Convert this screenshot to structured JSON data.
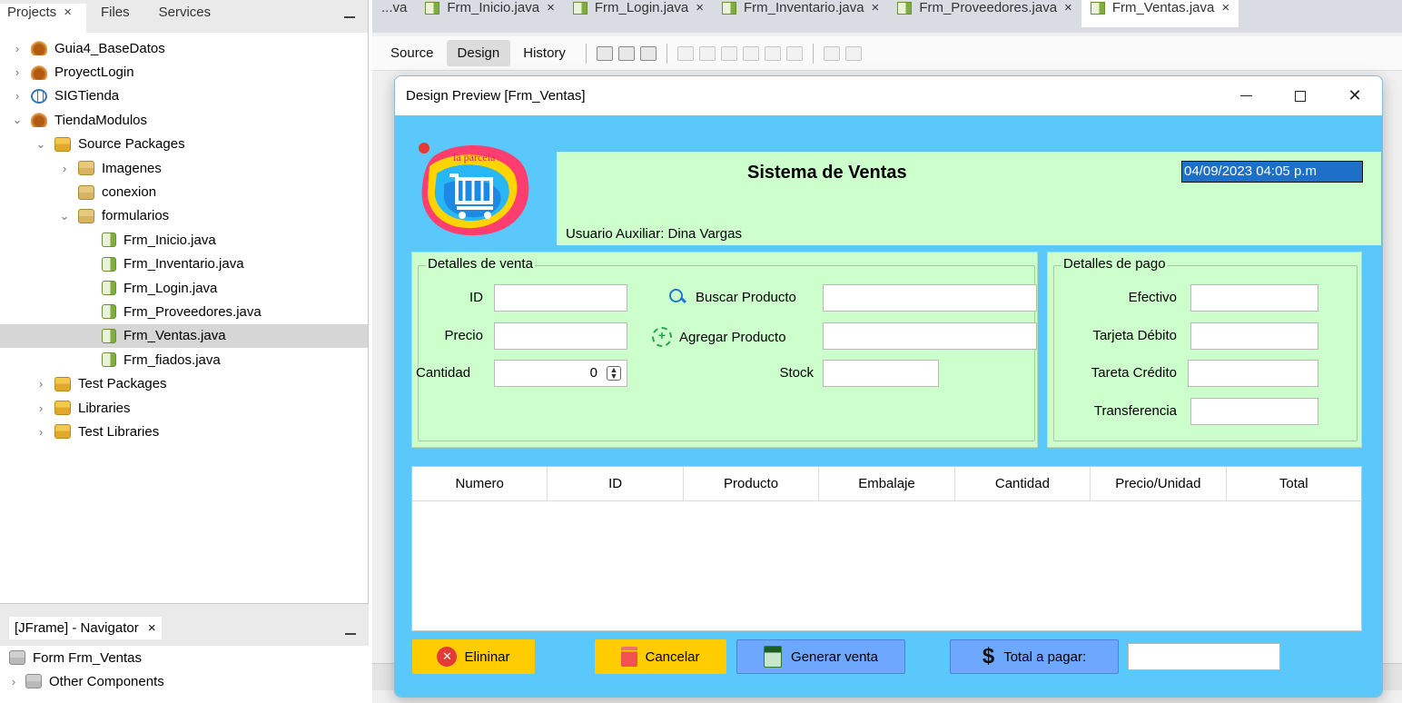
{
  "left_panel": {
    "tabs": [
      {
        "label": "Projects",
        "close": "×"
      },
      {
        "label": "Files"
      },
      {
        "label": "Services"
      }
    ],
    "tree": [
      {
        "label": "Guia4_BaseDatos",
        "icon": "coffee-cup-icon",
        "level": 0,
        "expander": "›"
      },
      {
        "label": "ProyectLogin",
        "icon": "coffee-cup-icon",
        "level": 0,
        "expander": "›"
      },
      {
        "label": "SIGTienda",
        "icon": "globe-icon",
        "level": 0,
        "expander": "›"
      },
      {
        "label": "TiendaModulos",
        "icon": "coffee-cup-icon",
        "level": 0,
        "expander": "⌄"
      },
      {
        "label": "Source Packages",
        "icon": "source-packages-icon",
        "level": 1,
        "expander": "⌄"
      },
      {
        "label": "Imagenes",
        "icon": "package-icon",
        "level": 2,
        "expander": "›"
      },
      {
        "label": "conexion",
        "icon": "package-icon",
        "level": 2,
        "expander": ""
      },
      {
        "label": "formularios",
        "icon": "package-icon",
        "level": 2,
        "expander": "⌄"
      },
      {
        "label": "Frm_Inicio.java",
        "icon": "java-form-icon",
        "level": 3,
        "expander": ""
      },
      {
        "label": "Frm_Inventario.java",
        "icon": "java-form-icon",
        "level": 3,
        "expander": ""
      },
      {
        "label": "Frm_Login.java",
        "icon": "java-form-icon",
        "level": 3,
        "expander": ""
      },
      {
        "label": "Frm_Proveedores.java",
        "icon": "java-form-icon",
        "level": 3,
        "expander": ""
      },
      {
        "label": "Frm_Ventas.java",
        "icon": "java-form-icon",
        "level": 3,
        "expander": "",
        "selected": true
      },
      {
        "label": "Frm_fiados.java",
        "icon": "java-form-icon",
        "level": 3,
        "expander": ""
      },
      {
        "label": "Test Packages",
        "icon": "test-packages-icon",
        "level": 1,
        "expander": "›"
      },
      {
        "label": "Libraries",
        "icon": "libraries-icon",
        "level": 1,
        "expander": "›"
      },
      {
        "label": "Test Libraries",
        "icon": "libraries-icon",
        "level": 1,
        "expander": "›"
      }
    ]
  },
  "navigator": {
    "tab_label": "[JFrame] - Navigator",
    "close": "×",
    "rows": [
      {
        "label": "Form Frm_Ventas",
        "expander": ""
      },
      {
        "label": "Other Components",
        "expander": "›"
      }
    ]
  },
  "editor": {
    "tabs": [
      {
        "label": "...va"
      },
      {
        "label": "Frm_Inicio.java",
        "close": "×"
      },
      {
        "label": "Frm_Login.java",
        "close": "×"
      },
      {
        "label": "Frm_Inventario.java",
        "close": "×"
      },
      {
        "label": "Frm_Proveedores.java",
        "close": "×"
      },
      {
        "label": "Frm_Ventas.java",
        "close": "×",
        "selected": true
      }
    ],
    "toolbar": {
      "source": "Source",
      "design": "Design",
      "history": "History"
    }
  },
  "preview": {
    "title": "Design Preview [Frm_Ventas]",
    "controls": {
      "minimize": "—",
      "maximize": "□",
      "close": "✕"
    },
    "logo_text": "la parcela",
    "header": {
      "title": "Sistema de Ventas",
      "user": "Usuario Auxiliar: Dina Vargas",
      "datetime": "04/09/2023    04:05 p.m"
    },
    "venta": {
      "legend": "Detalles de venta",
      "id_label": "ID",
      "precio_label": "Precio",
      "cantidad_label": "Cantidad",
      "cantidad_value": "0",
      "buscar": "Buscar Producto",
      "agregar": "Agregar Producto",
      "stock_label": "Stock"
    },
    "pago": {
      "legend": "Detalles de pago",
      "efectivo": "Efectivo",
      "debito": "Tarjeta Débito",
      "credito": "Tareta Crédito",
      "transferencia": "Transferencia"
    },
    "table": {
      "columns": [
        "Numero",
        "ID",
        "Producto",
        "Embalaje",
        "Cantidad",
        "Precio/Unidad",
        "Total"
      ]
    },
    "buttons": {
      "eliminar": "Elininar",
      "cancelar": "Cancelar",
      "generar": "Generar venta",
      "total": "Total a pagar:"
    }
  },
  "colors": {
    "frame_bg": "#5ac8fa",
    "panel_bg": "#ccffcc",
    "yellow_button": "#ffcc00",
    "blue_button": "#6ea8fe",
    "selection": "#1e6fc7"
  }
}
